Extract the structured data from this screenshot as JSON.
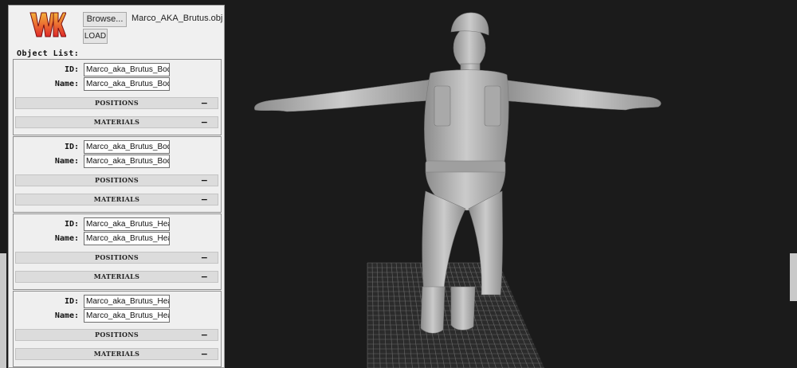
{
  "toolbar": {
    "browse_label": "Browse...",
    "load_label": "LOAD",
    "file_name": "Marco_AKA_Brutus.obj"
  },
  "object_list": {
    "title": "Object List:",
    "id_label": "ID:",
    "name_label": "Name:",
    "positions_label": "POSITIONS",
    "materials_label": "MATERIALS",
    "toggle_symbol": "−",
    "items": [
      {
        "id": "Marco_aka_Brutus_Body.",
        "name": "Marco_aka_Brutus_Body."
      },
      {
        "id": "Marco_aka_Brutus_Body",
        "name": "Marco_aka_Brutus_Body"
      },
      {
        "id": "Marco_aka_Brutus_Head",
        "name": "Marco_aka_Brutus_Head"
      },
      {
        "id": "Marco_aka_Brutus_Head",
        "name": "Marco_aka_Brutus_Head"
      }
    ]
  },
  "colors": {
    "viewport_bg": "#1b1b1b",
    "grid_line": "#6a6a6a",
    "model": "#b9b9b9",
    "panel_bg": "#f0f0f0"
  },
  "icons": {
    "logo": "wk-logo-icon"
  }
}
